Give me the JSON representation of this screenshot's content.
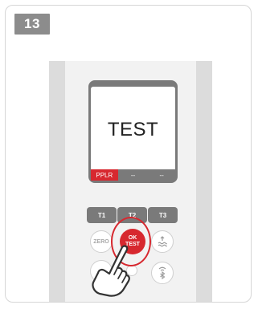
{
  "step": {
    "number": "13"
  },
  "display": {
    "main_text": "TEST",
    "tabs": [
      "PPLR",
      "--",
      "--"
    ]
  },
  "buttons": {
    "t1": "T1",
    "t2": "T2",
    "t3": "T3",
    "zero": "ZERO",
    "ok_line1": "OK",
    "ok_line2": "TEST"
  },
  "colors": {
    "accent": "#d7282f",
    "button_gray": "#7a7a7a"
  },
  "icons": [
    "hand-pointer-icon",
    "tide-icon",
    "bluetooth-icon"
  ]
}
